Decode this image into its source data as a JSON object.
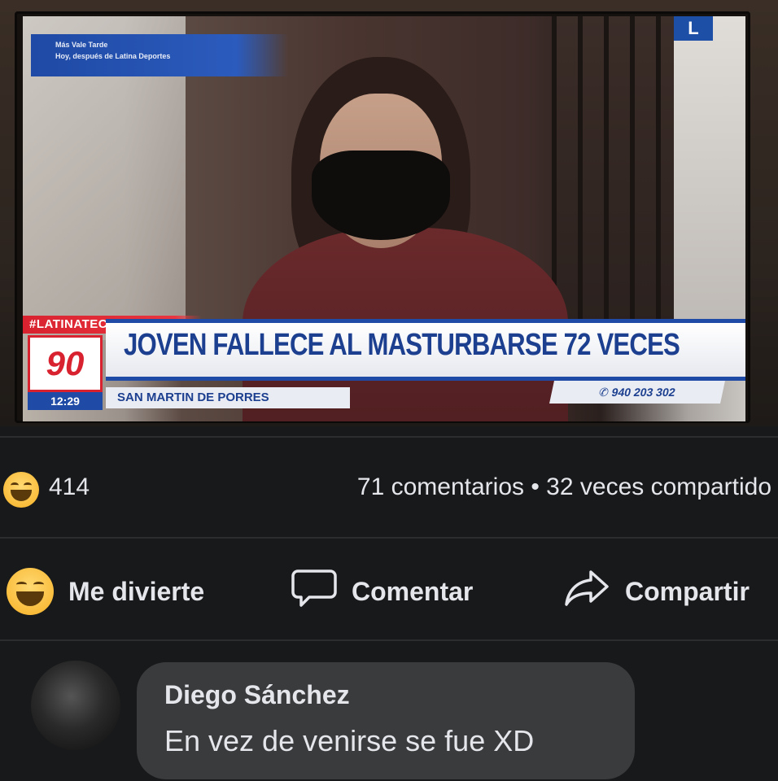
{
  "photo": {
    "network_logo": "L",
    "top_label_line1": "Más Vale Tarde",
    "top_label_line2": "Hoy, después de Latina Deportes",
    "hashtag": "#LATINATECUIDA",
    "channel_badge": "90",
    "time": "12:29",
    "headline": "JOVEN FALLECE AL MASTURBARSE 72 VECES",
    "location": "SAN MARTIN DE PORRES",
    "phone": "940 203 302"
  },
  "stats": {
    "reaction_icon": "haha-emoji-icon",
    "reaction_count": "414",
    "comments_and_shares": "71 comentarios • 32 veces compartido"
  },
  "actions": {
    "like_label": "Me divierte",
    "like_icon": "haha-emoji-icon",
    "comment_label": "Comentar",
    "comment_icon": "speech-bubble-icon",
    "share_label": "Compartir",
    "share_icon": "share-arrow-icon"
  },
  "comment": {
    "author": "Diego Sánchez",
    "text": "En vez de venirse se fue XD"
  },
  "colors": {
    "background": "#18191a",
    "bubble": "#3a3b3c",
    "text": "#e4e6eb",
    "headline_blue": "#1c3f8f",
    "accent_red": "#d92230"
  }
}
